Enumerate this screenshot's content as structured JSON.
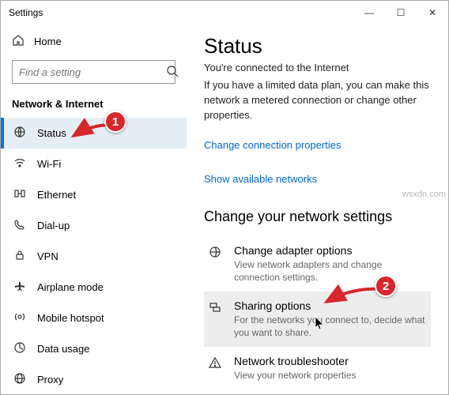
{
  "window": {
    "title": "Settings"
  },
  "sidebar": {
    "home": "Home",
    "search_placeholder": "Find a setting",
    "section": "Network & Internet",
    "items": [
      {
        "label": "Status"
      },
      {
        "label": "Wi-Fi"
      },
      {
        "label": "Ethernet"
      },
      {
        "label": "Dial-up"
      },
      {
        "label": "VPN"
      },
      {
        "label": "Airplane mode"
      },
      {
        "label": "Mobile hotspot"
      },
      {
        "label": "Data usage"
      },
      {
        "label": "Proxy"
      }
    ]
  },
  "main": {
    "heading": "Status",
    "subhead": "You're connected to the Internet",
    "description": "If you have a limited data plan, you can make this network a metered connection or change other properties.",
    "link1": "Change connection properties",
    "link2": "Show available networks",
    "settings_heading": "Change your network settings",
    "options": [
      {
        "title": "Change adapter options",
        "desc": "View network adapters and change connection settings."
      },
      {
        "title": "Sharing options",
        "desc": "For the networks you connect to, decide what you want to share."
      },
      {
        "title": "Network troubleshooter",
        "desc": "View your network properties"
      }
    ]
  },
  "annotations": {
    "badge1": "1",
    "badge2": "2"
  },
  "watermark": "wsxdn.com"
}
